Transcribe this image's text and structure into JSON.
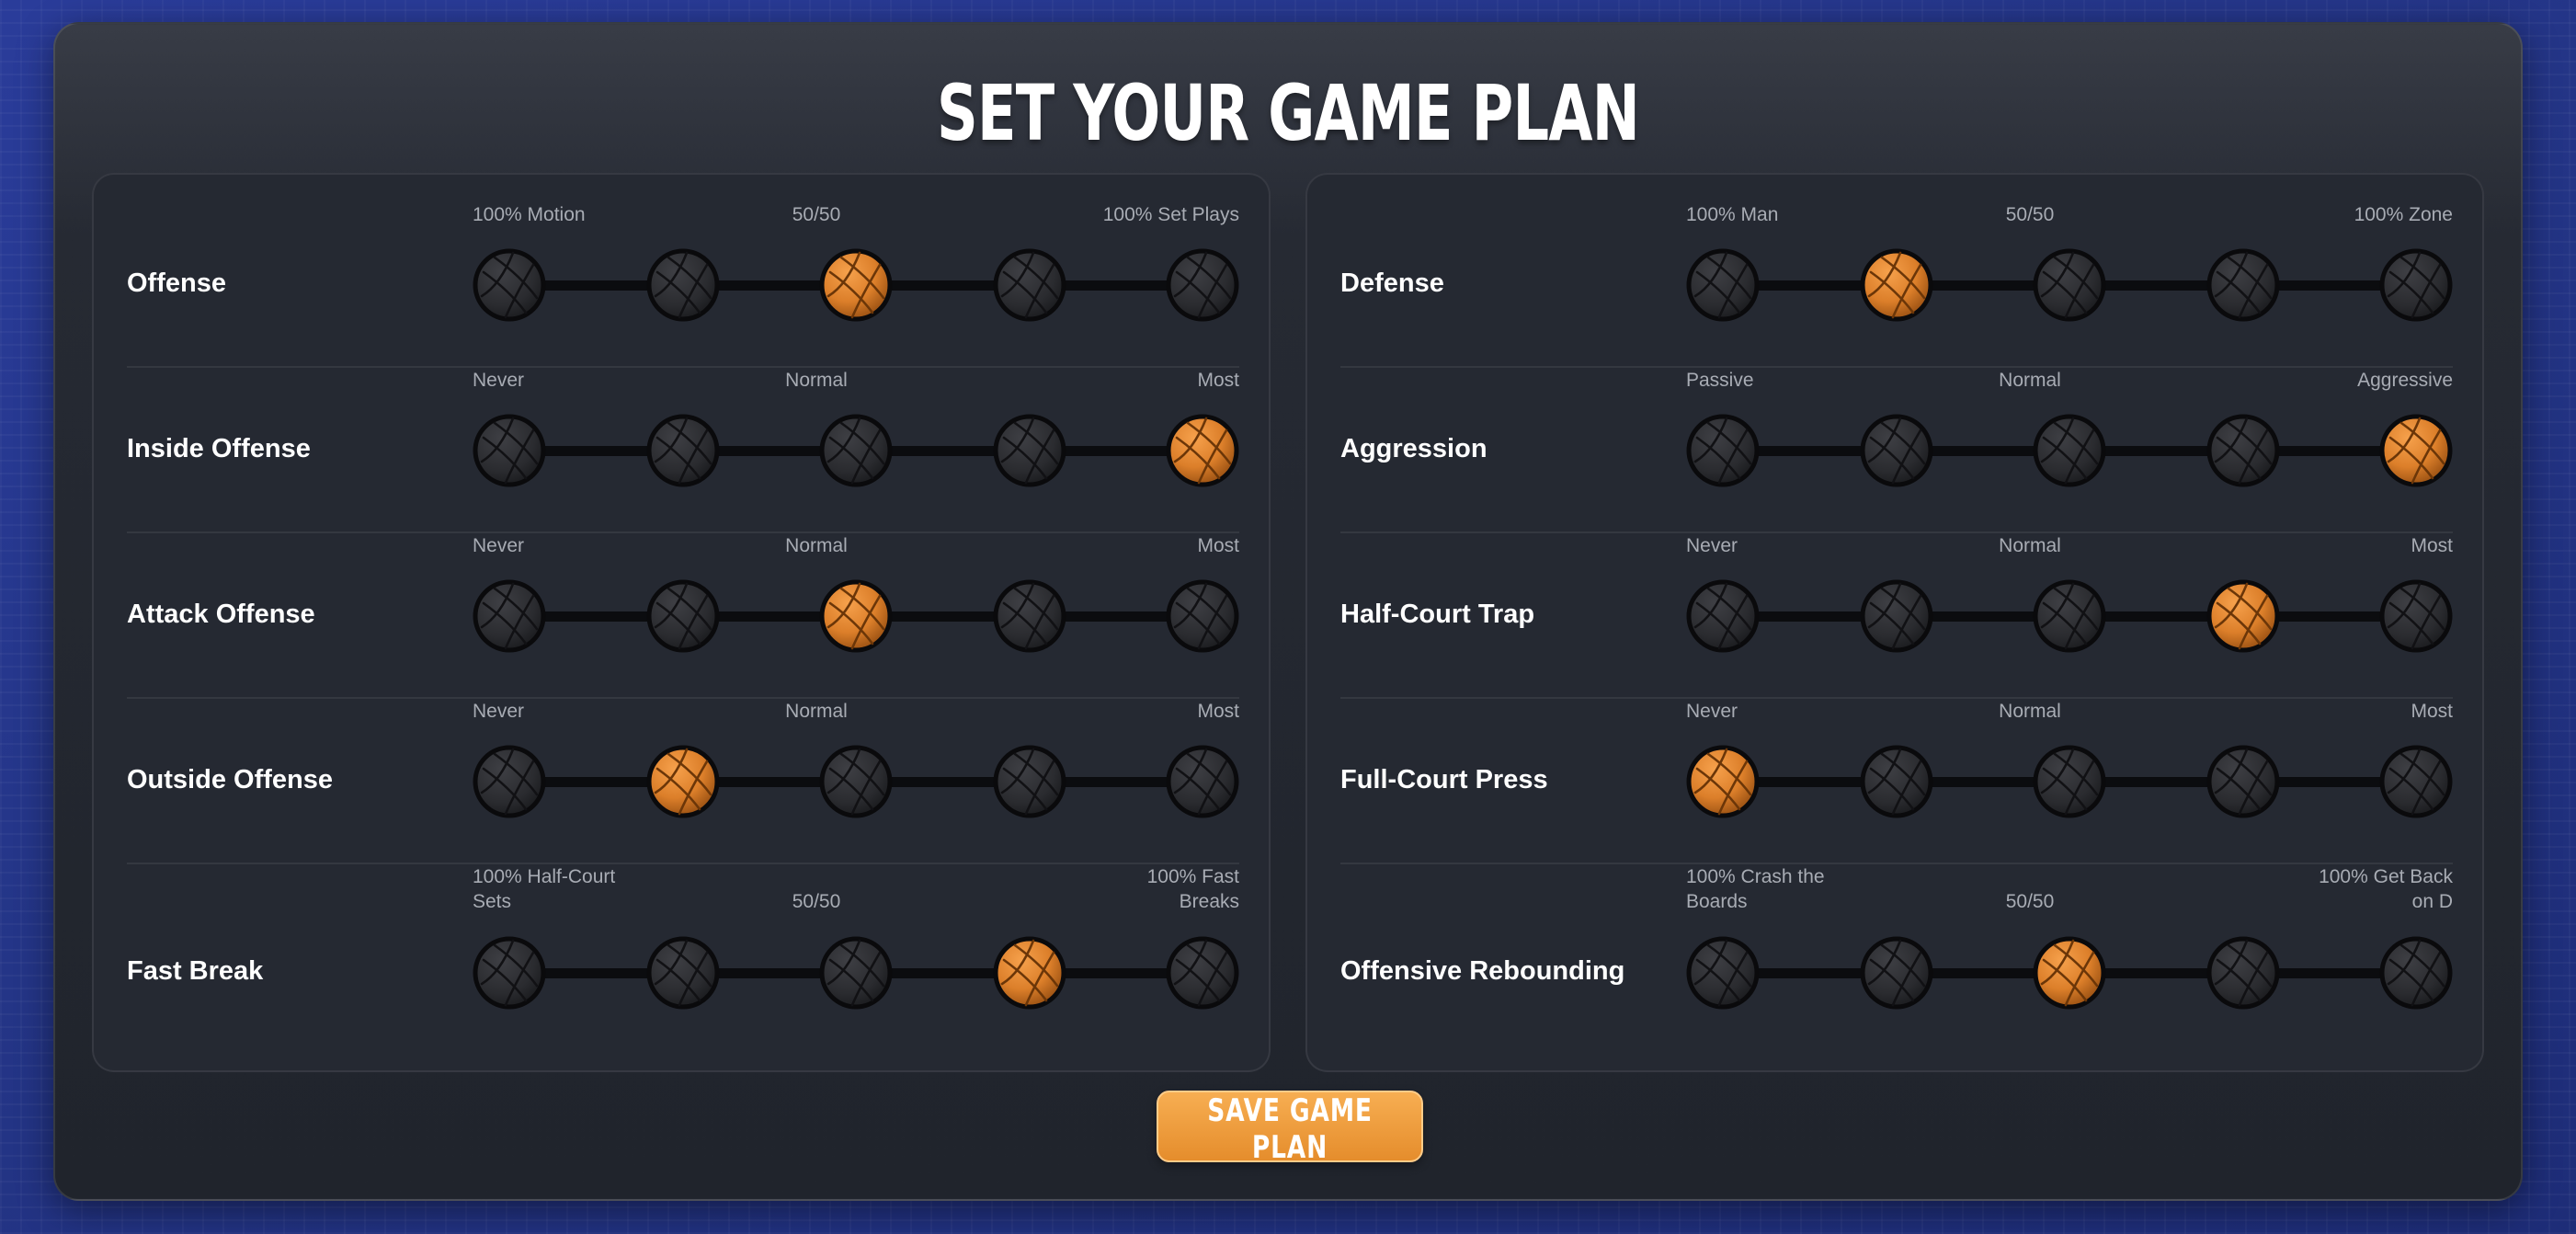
{
  "title": "SET YOUR GAME PLAN",
  "save_button": "SAVE GAME PLAN",
  "colors": {
    "accent": "#e8922e",
    "inactive_ball": "#2b2c30",
    "panel": "#252932"
  },
  "ball_icon": "basketball-icon",
  "offense": [
    {
      "label": "Offense",
      "low": "100% Motion",
      "mid": "50/50",
      "high": "100% Set Plays",
      "selected": 3,
      "steps": 5
    },
    {
      "label": "Inside Offense",
      "low": "Never",
      "mid": "Normal",
      "high": "Most",
      "selected": 5,
      "steps": 5
    },
    {
      "label": "Attack Offense",
      "low": "Never",
      "mid": "Normal",
      "high": "Most",
      "selected": 3,
      "steps": 5
    },
    {
      "label": "Outside Offense",
      "low": "Never",
      "mid": "Normal",
      "high": "Most",
      "selected": 2,
      "steps": 5
    },
    {
      "label": "Fast Break",
      "low": "100% Half-Court Sets",
      "mid": "50/50",
      "high": "100% Fast Breaks",
      "selected": 4,
      "steps": 5
    }
  ],
  "defense": [
    {
      "label": "Defense",
      "low": "100% Man",
      "mid": "50/50",
      "high": "100% Zone",
      "selected": 2,
      "steps": 5
    },
    {
      "label": "Aggression",
      "low": "Passive",
      "mid": "Normal",
      "high": "Aggressive",
      "selected": 5,
      "steps": 5
    },
    {
      "label": "Half-Court Trap",
      "low": "Never",
      "mid": "Normal",
      "high": "Most",
      "selected": 4,
      "steps": 5
    },
    {
      "label": "Full-Court Press",
      "low": "Never",
      "mid": "Normal",
      "high": "Most",
      "selected": 1,
      "steps": 5
    },
    {
      "label": "Offensive Rebounding",
      "low": "100% Crash the Boards",
      "mid": "50/50",
      "high": "100% Get Back on D",
      "selected": 3,
      "steps": 5
    }
  ]
}
